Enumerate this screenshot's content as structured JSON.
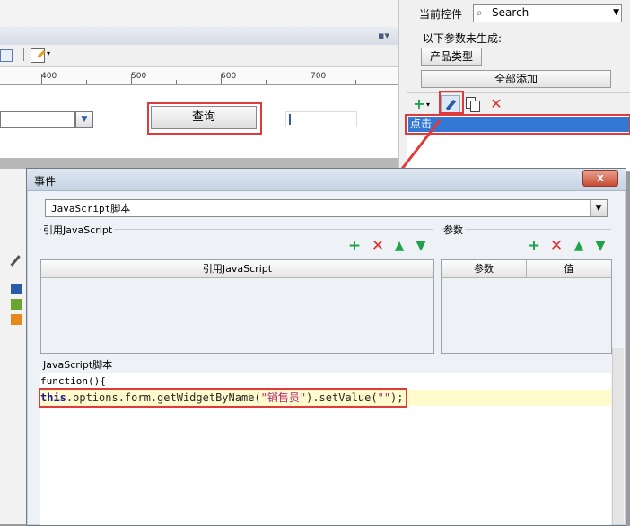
{
  "designer": {
    "ruler_labels": [
      "400",
      "500",
      "600",
      "700"
    ],
    "query_button_label": "查询"
  },
  "right_panel": {
    "current_control_label": "当前控件",
    "current_control_value": "Search",
    "params_note": "以下参数未生成:",
    "param_chip": "产品类型",
    "add_all_button": "全部添加",
    "event_item": "点击"
  },
  "dialog": {
    "title": "事件",
    "close_glyph": "x",
    "script_type": "JavaScript脚本",
    "ref_group_label": "引用JavaScript",
    "param_group_label": "参数",
    "ref_table_header": "引用JavaScript",
    "param_table_headers": [
      "参数",
      "值"
    ],
    "script_group_label": "JavaScript脚本",
    "code_function_line": "function(){",
    "code": {
      "keyword": "this",
      "chain": ".options.form.getWidgetByName(",
      "arg_string": "\"销售员\"",
      "chain2": ").setValue(",
      "arg_empty": "\"\"",
      "end": ");"
    }
  },
  "colors": {
    "highlight": "#e03a3a",
    "selection": "#3478d6",
    "code_bg": "#fffbcc"
  }
}
